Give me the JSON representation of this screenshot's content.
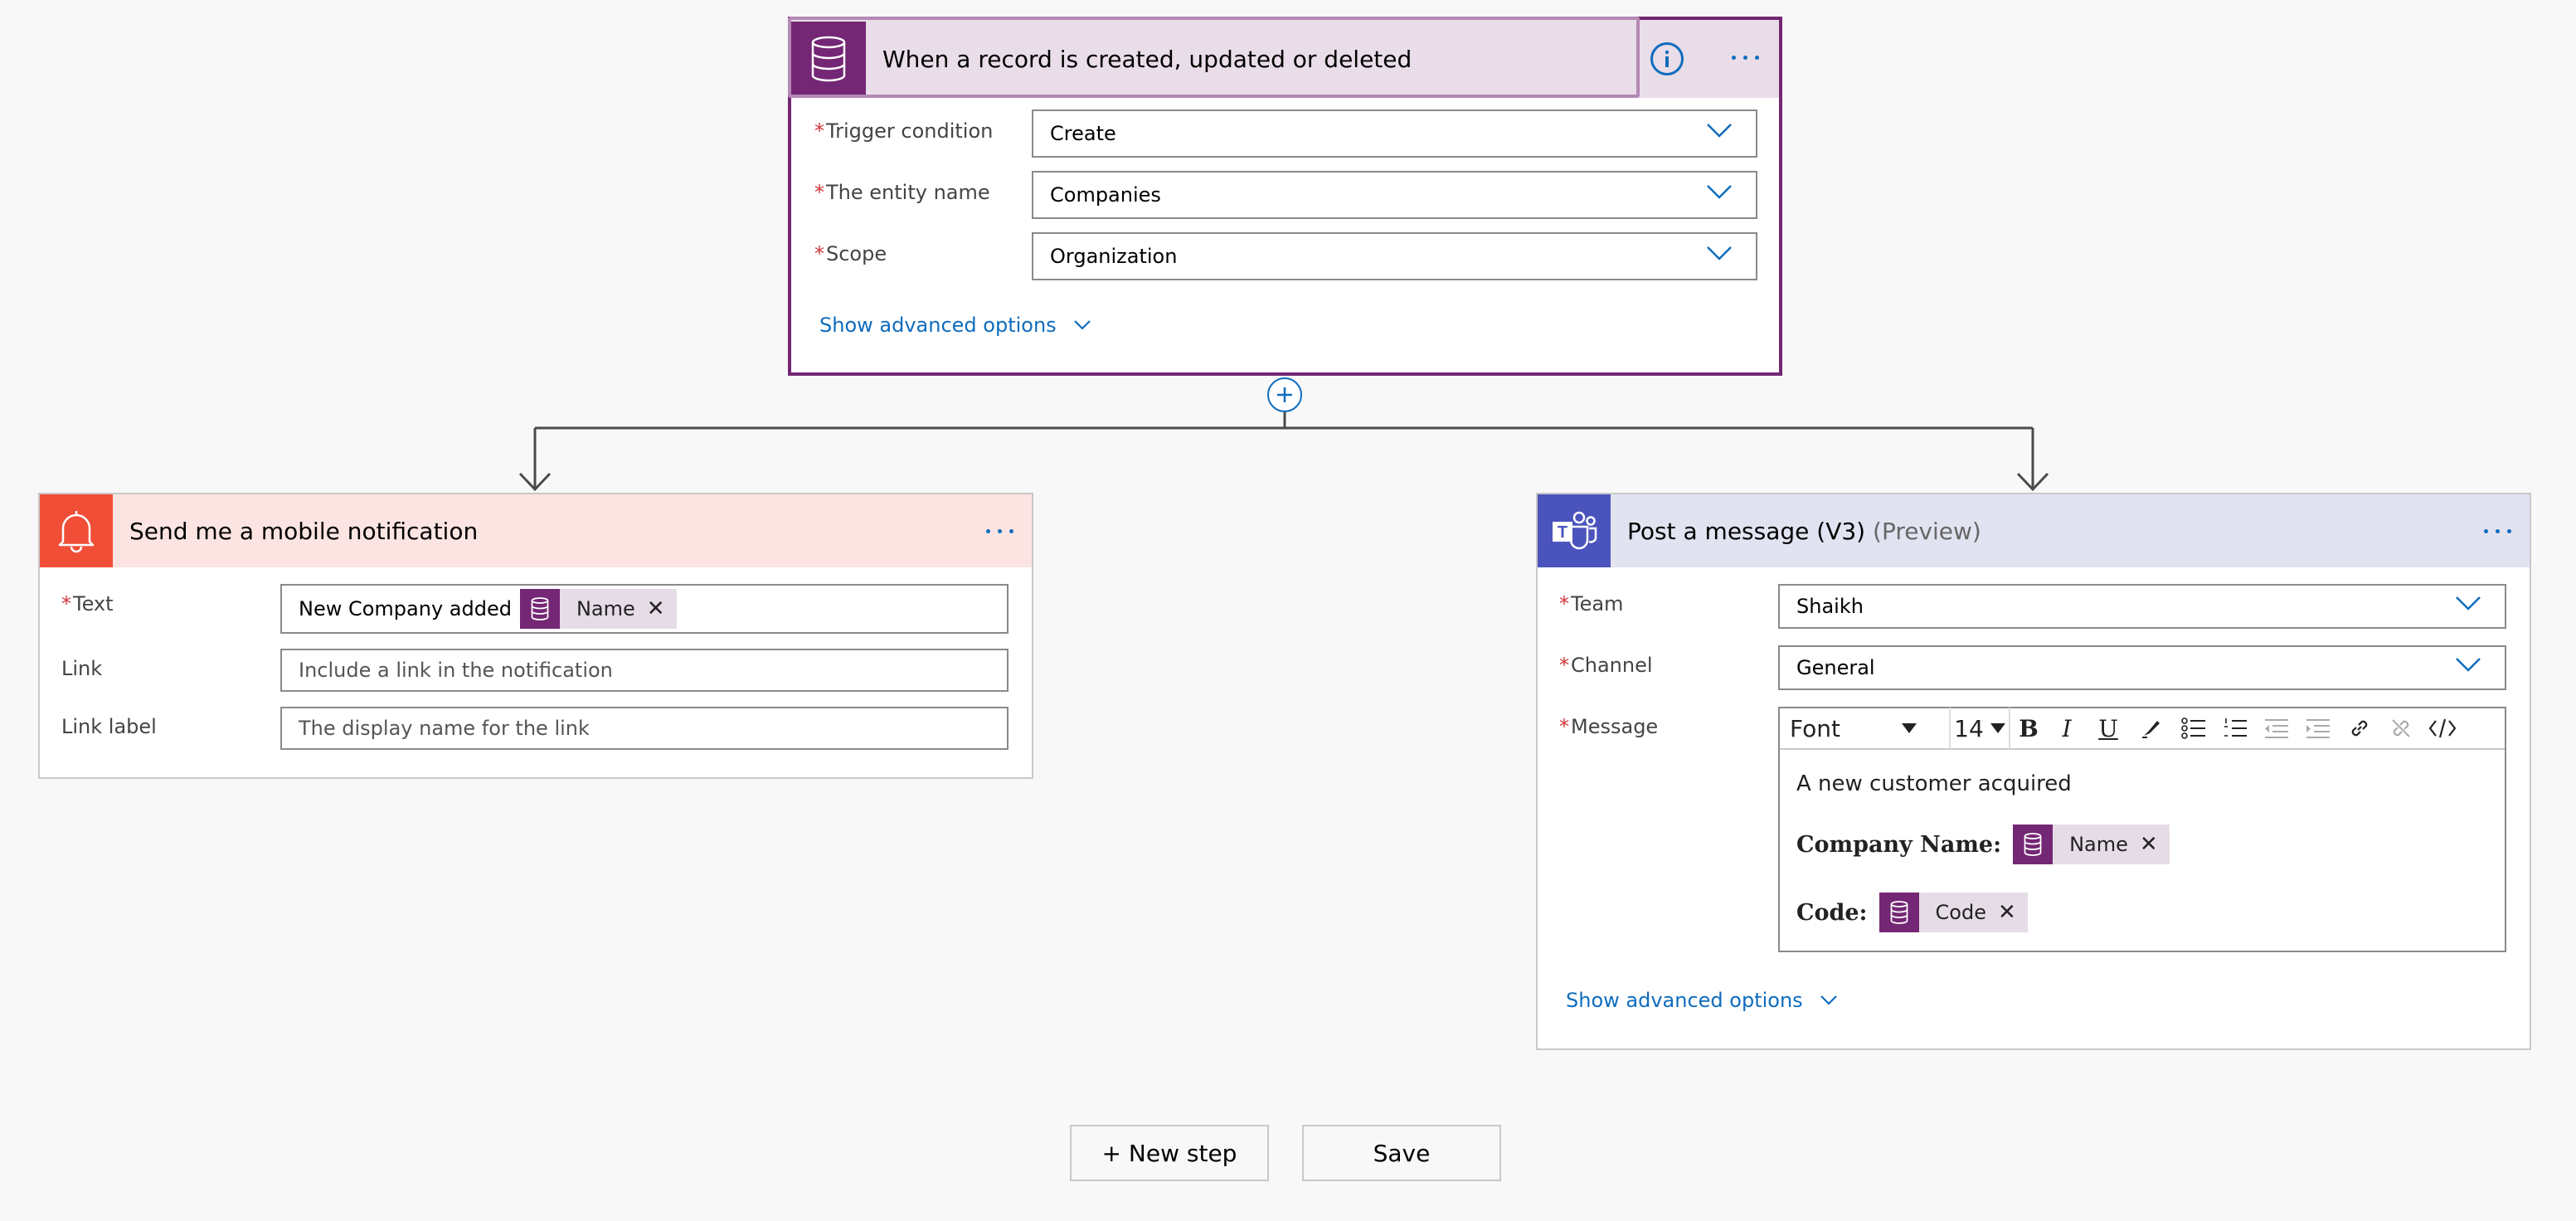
{
  "trigger": {
    "title": "When a record is created, updated or deleted",
    "fields": [
      {
        "label": "Trigger condition",
        "value": "Create",
        "required": true
      },
      {
        "label": "The entity name",
        "value": "Companies",
        "required": true
      },
      {
        "label": "Scope",
        "value": "Organization",
        "required": true
      }
    ],
    "advanced_link": "Show advanced options"
  },
  "notification": {
    "title": "Send me a mobile notification",
    "text_label": "Text",
    "text_prefix": "New Company added",
    "text_token": "Name",
    "link_label": "Link",
    "link_placeholder": "Include a link in the notification",
    "link_label_label": "Link label",
    "link_label_placeholder": "The display name for the link"
  },
  "teams": {
    "title": "Post a message (V3)",
    "title_suffix": "(Preview)",
    "team_label": "Team",
    "team_value": "Shaikh",
    "channel_label": "Channel",
    "channel_value": "General",
    "message_label": "Message",
    "toolbar": {
      "font": "Font",
      "size": "14"
    },
    "message_line1": "A new customer acquired",
    "company_label": "Company Name:",
    "company_token": "Name",
    "code_label": "Code:",
    "code_token": "Code",
    "advanced_link": "Show advanced options"
  },
  "footer": {
    "new_step": "+ New step",
    "save": "Save"
  },
  "colors": {
    "dataverse_purple": "#742774",
    "notification_red": "#f04e37",
    "teams_indigo": "#4b53bc",
    "link_blue": "#0f6cbd"
  },
  "icons": [
    "database-icon",
    "info-icon",
    "more-options-icon",
    "bell-icon",
    "teams-icon",
    "chevron-down-icon",
    "add-icon",
    "close-icon"
  ]
}
